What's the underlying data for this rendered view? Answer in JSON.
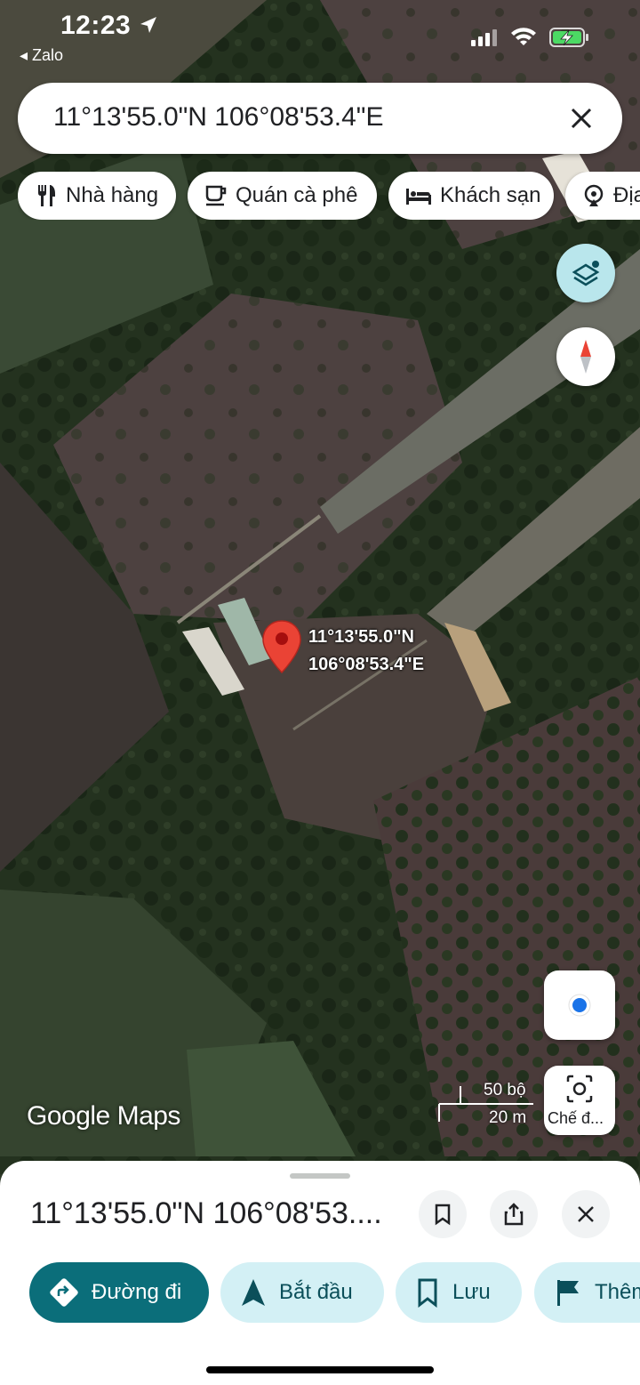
{
  "status_bar": {
    "time": "12:23",
    "back_app": "Zalo"
  },
  "search": {
    "query": "11°13'55.0\"N 106°08'53.4\"E"
  },
  "chips": [
    {
      "label": "Nhà hàng",
      "icon": "restaurant-icon"
    },
    {
      "label": "Quán cà phê",
      "icon": "coffee-icon"
    },
    {
      "label": "Khách sạn",
      "icon": "hotel-icon"
    },
    {
      "label": "Địa",
      "icon": "attractions-icon"
    }
  ],
  "map": {
    "pin_label_line1": "11°13'55.0\"N",
    "pin_label_line2": "106°08'53.4\"E",
    "scale_imperial": "50 bộ",
    "scale_metric": "20 m",
    "logo": "Google Maps",
    "street_view_label": "Chế đ..."
  },
  "sheet": {
    "title": "11°13'55.0\"N 106°08'53....",
    "actions": [
      {
        "label": "Đường đi",
        "icon": "directions-icon",
        "primary": true
      },
      {
        "label": "Bắt đầu",
        "icon": "navigation-arrow-icon",
        "primary": false
      },
      {
        "label": "Lưu",
        "icon": "bookmark-icon",
        "primary": false
      },
      {
        "label": "Thêm",
        "icon": "flag-icon",
        "primary": false
      }
    ]
  },
  "colors": {
    "primary": "#0b6e7a",
    "chip_bg": "#d3f0f5",
    "pin": "#ea4335"
  }
}
